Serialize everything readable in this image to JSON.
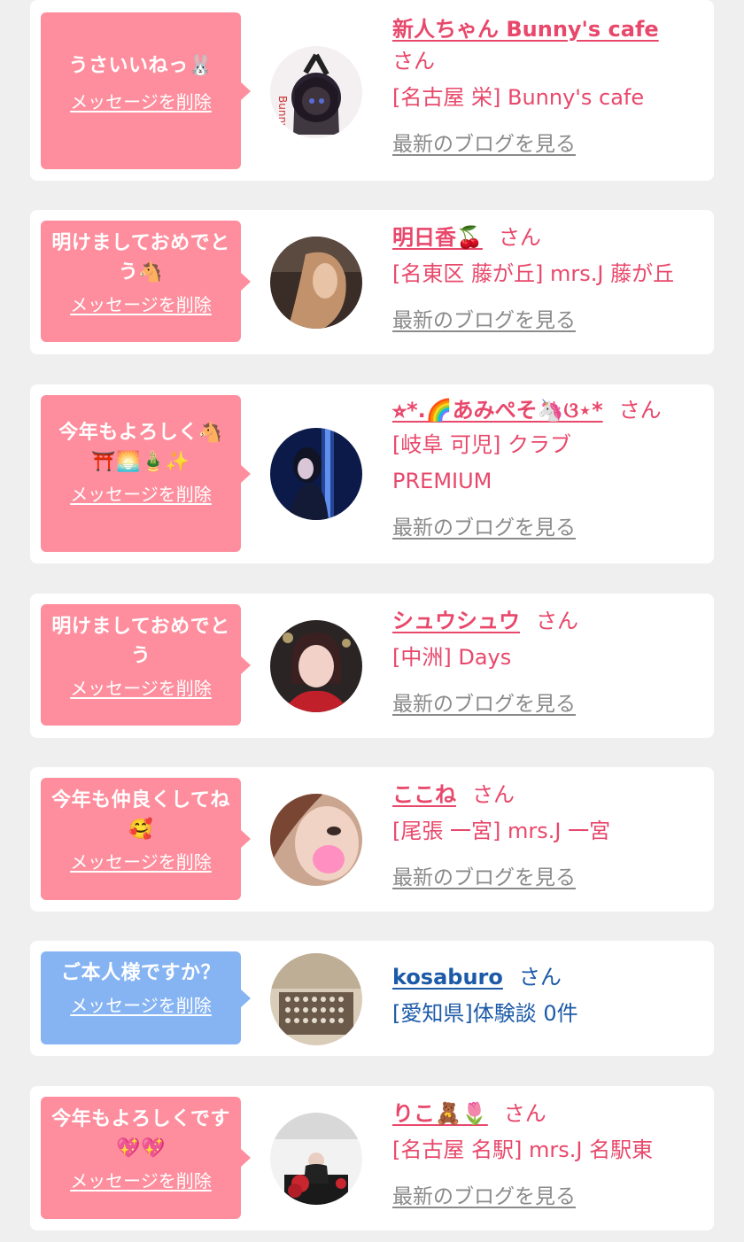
{
  "delete_label": "メッセージを削除",
  "blog_label": "最新のブログを見る",
  "suffix": "さん",
  "colors": {
    "pink_bubble": "#fe8e9d",
    "blue_bubble": "#86b4f3",
    "name_pink": "#e8486b",
    "name_blue": "#1c5aa8",
    "link_gray": "#8a8a8a",
    "background": "#efefef"
  },
  "entries": [
    {
      "message": "うさいいねっ🐰",
      "name": "新人ちゃん Bunny's cafe",
      "shop": "[名古屋 栄] Bunny's cafe",
      "type": "pink"
    },
    {
      "message": "明けましておめでとう🐴",
      "name": "明日香🍒",
      "shop": "[名東区 藤が丘] mrs.J 藤が丘",
      "type": "pink"
    },
    {
      "message": "今年もよろしく🐴⛩️🌅🎍✨",
      "name": "⭐︎*.🌈あみぺそ🦄ଓ⋆*",
      "shop": "[岐阜 可児] クラブPREMIUM",
      "type": "pink"
    },
    {
      "message": "明けましておめでとう",
      "name": "シュウシュウ",
      "shop": "[中洲] Days",
      "type": "pink"
    },
    {
      "message": "今年も仲良くしてね🥰",
      "name": "ここね",
      "shop": "[尾張 一宮] mrs.J 一宮",
      "type": "pink"
    },
    {
      "message": "ご本人様ですか？",
      "name": "kosaburo",
      "shop": "[愛知県]体験談 0件",
      "type": "blue"
    },
    {
      "message": "今年もよろしくです💖💖",
      "name": "りこ🧸🌷",
      "shop": "[名古屋 名駅] mrs.J 名駅東",
      "type": "pink"
    }
  ]
}
